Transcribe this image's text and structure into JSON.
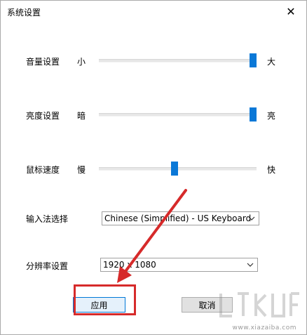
{
  "window": {
    "title": "系统设置",
    "close_glyph": "✕"
  },
  "settings": {
    "volume": {
      "label": "音量设置",
      "min_label": "小",
      "max_label": "大",
      "value_pct": 100
    },
    "brightness": {
      "label": "亮度设置",
      "min_label": "暗",
      "max_label": "亮",
      "value_pct": 100
    },
    "mouse_speed": {
      "label": "鼠标速度",
      "min_label": "慢",
      "max_label": "快",
      "value_pct": 48
    },
    "input_method": {
      "label": "输入法选择",
      "selected": "Chinese (Simplified) - US Keyboard"
    },
    "resolution": {
      "label": "分辨率设置",
      "selected": "1920 x 1080"
    }
  },
  "buttons": {
    "apply": "应用",
    "cancel": "取消"
  },
  "colors": {
    "accent": "#0a78d7",
    "annotation": "#d62a2a"
  },
  "watermark": {
    "sub": "www.xiazaiba.com"
  }
}
